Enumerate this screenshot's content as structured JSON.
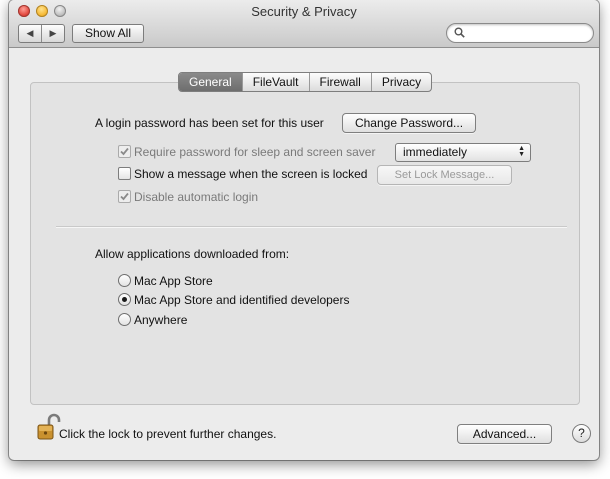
{
  "window": {
    "title": "Security & Privacy",
    "toolbar": {
      "back_icon": "back-arrow-icon",
      "forward_icon": "forward-arrow-icon",
      "show_all_label": "Show All",
      "search_placeholder": "",
      "search_icon": "magnifier-icon"
    }
  },
  "tabs": [
    {
      "label": "General",
      "active": true
    },
    {
      "label": "FileVault",
      "active": false
    },
    {
      "label": "Firewall",
      "active": false
    },
    {
      "label": "Privacy",
      "active": false
    }
  ],
  "general": {
    "login_password_text": "A login password has been set for this user",
    "change_password_label": "Change Password...",
    "require_password_label": "Require password for sleep and screen saver",
    "require_password_checked": true,
    "require_password_enabled": false,
    "require_password_interval": "immediately",
    "show_message_label": "Show a message when the screen is locked",
    "show_message_checked": false,
    "set_lock_message_label": "Set Lock Message...",
    "disable_auto_login_label": "Disable automatic login",
    "disable_auto_login_checked": true,
    "disable_auto_login_enabled": false,
    "allow_apps_heading": "Allow applications downloaded from:",
    "app_sources": [
      {
        "label": "Mac App Store",
        "selected": false
      },
      {
        "label": "Mac App Store and identified developers",
        "selected": true
      },
      {
        "label": "Anywhere",
        "selected": false
      }
    ]
  },
  "footer": {
    "lock_icon": "unlocked-padlock-icon",
    "lock_text": "Click the lock to prevent further changes.",
    "advanced_label": "Advanced...",
    "help_label": "?"
  }
}
